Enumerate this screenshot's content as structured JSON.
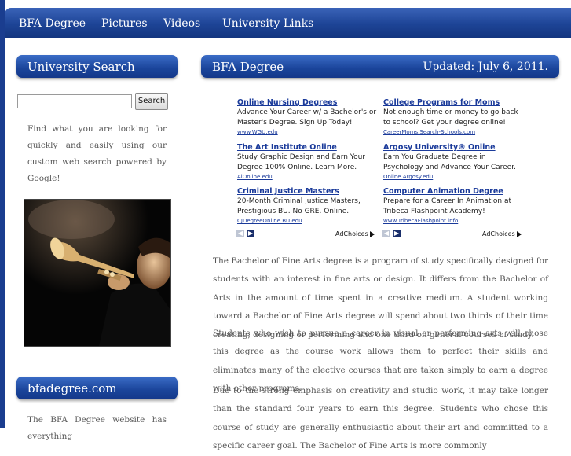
{
  "nav": {
    "items": [
      "BFA Degree",
      "Pictures",
      "Videos",
      "University Links"
    ]
  },
  "sidebar": {
    "search_title": "University Search",
    "search_button": "Search",
    "search_input_value": "",
    "search_description": "Find what you are looking for quickly and easily using our custom web search powered by Google!",
    "site_title": "bfadegree.com",
    "site_description": "The BFA Degree website has everything"
  },
  "main": {
    "title": "BFA Degree",
    "updated": "Updated: July 6, 2011."
  },
  "ads": [
    {
      "title": "Online Nursing Degrees",
      "desc": "Advance Your Career w/ a Bachelor's or Master's Degree. Sign Up Today!",
      "url": "www.WGU.edu"
    },
    {
      "title": "College Programs for Moms",
      "desc": "Not enough time or money to go back to school? Get your degree online!",
      "url": "CareerMoms.Search-Schools.com"
    },
    {
      "title": "The Art Institute Online",
      "desc": "Study Graphic Design and Earn Your Degree 100% Online. Learn More.",
      "url": "AiOnline.edu"
    },
    {
      "title": "Argosy University® Online",
      "desc": "Earn You Graduate Degree in Psychology and Advance Your Career.",
      "url": "Online.Argosy.edu"
    },
    {
      "title": "Criminal Justice Masters",
      "desc": "20-Month Criminal Justice Masters, Prestigious BU. No GRE. Online.",
      "url": "CJDegreeOnline.BU.edu"
    },
    {
      "title": "Computer Animation Degree",
      "desc": "Prepare for a Career In Animation at Tribeca Flashpoint Academy!",
      "url": "www.TribecaFlashpoint.info"
    }
  ],
  "adchoices": "AdChoices",
  "article": {
    "p1": "The Bachelor of Fine Arts degree is a program of study specifically designed for students with an interest in fine arts or design. It differs from the Bachelor of Arts in the amount of time spent in a creative medium. A student working toward a Bachelor of Fine Arts degree will spend about two thirds of their time creating, designing or performing and one third on general courses of study.",
    "p2": "Students who wish to pursue a career in visual or performing arts will chose this degree as the course work allows them to perfect their skills and eliminates many of the elective courses that are taken simply to earn a degree with other programs.",
    "p3": "Due to the strong emphasis on creativity and studio work, it may take longer than the standard four years to earn this degree. Students who chose this course of study are generally enthusiastic about their art and committed to a specific career goal. The Bachelor of Fine Arts is more commonly"
  },
  "colors": {
    "nav_blue": "#1d4496",
    "header_blue": "#1a449a",
    "ad_link": "#1a3a9a",
    "body_text": "#555555"
  }
}
